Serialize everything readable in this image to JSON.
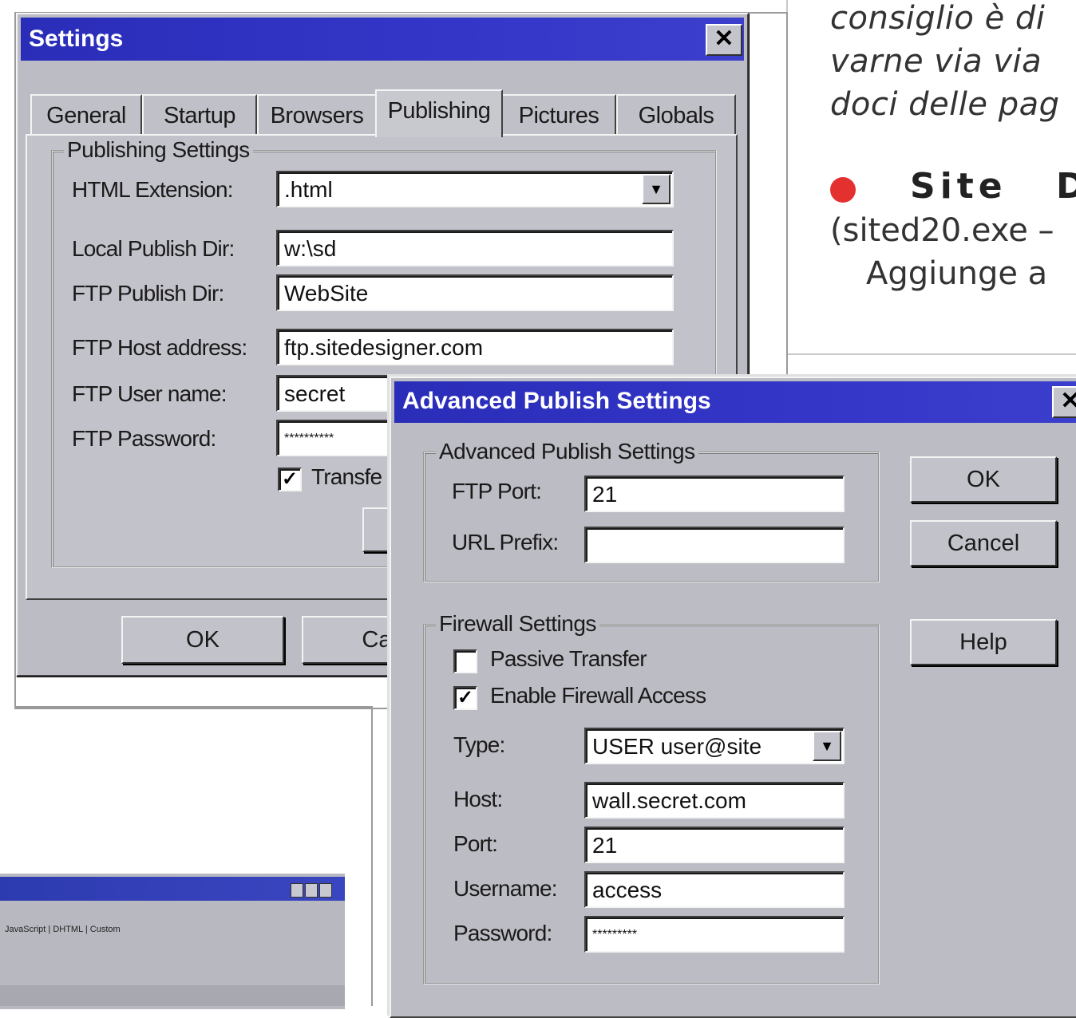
{
  "magazine": {
    "line1": "consiglio è di",
    "line2": "varne via via",
    "line3": "doci delle pag",
    "heading_word1": "Site",
    "heading_word2": "D",
    "line4": "(sited20.exe –",
    "line5": "Aggiunge a"
  },
  "settings": {
    "title": "Settings",
    "close_symbol": "✕",
    "tabs": [
      {
        "label": "General"
      },
      {
        "label": "Startup"
      },
      {
        "label": "Browsers"
      },
      {
        "label": "Publishing"
      },
      {
        "label": "Pictures"
      },
      {
        "label": "Globals"
      }
    ],
    "active_tab": "Publishing",
    "group_label": "Publishing Settings",
    "html_extension_label": "HTML Extension:",
    "html_extension_value": ".html",
    "local_dir_label": "Local Publish Dir:",
    "local_dir_value": "w:\\sd",
    "ftp_dir_label": "FTP Publish Dir:",
    "ftp_dir_value": "WebSite",
    "ftp_host_label": "FTP Host address:",
    "ftp_host_value": "ftp.sitedesigner.com",
    "ftp_user_label": "FTP User name:",
    "ftp_user_value": "secret",
    "ftp_password_label": "FTP Password:",
    "ftp_password_value": "**********",
    "transfer_check_label": "Transfe",
    "ok_label": "OK",
    "cancel_label": "Can"
  },
  "advanced": {
    "title": "Advanced Publish Settings",
    "close_symbol": "✕",
    "group1_label": "Advanced Publish Settings",
    "ftp_port_label": "FTP Port:",
    "ftp_port_value": "21",
    "url_prefix_label": "URL Prefix:",
    "url_prefix_value": "",
    "group2_label": "Firewall Settings",
    "passive_label": "Passive Transfer",
    "passive_checked": false,
    "firewall_label": "Enable Firewall Access",
    "firewall_checked": true,
    "type_label": "Type:",
    "type_value": "USER user@site",
    "host_label": "Host:",
    "host_value": "wall.secret.com",
    "port_label": "Port:",
    "port_value": "21",
    "username_label": "Username:",
    "username_value": "access",
    "password_label": "Password:",
    "password_value": "*********",
    "ok_label": "OK",
    "cancel_label": "Cancel",
    "help_label": "Help"
  },
  "background_window": {
    "tabs_text": "JavaScript | DHTML | Custom"
  },
  "colors": {
    "titlebar": "#2a2db8",
    "face": "#c2c2ca",
    "bullet": "#e53030"
  }
}
